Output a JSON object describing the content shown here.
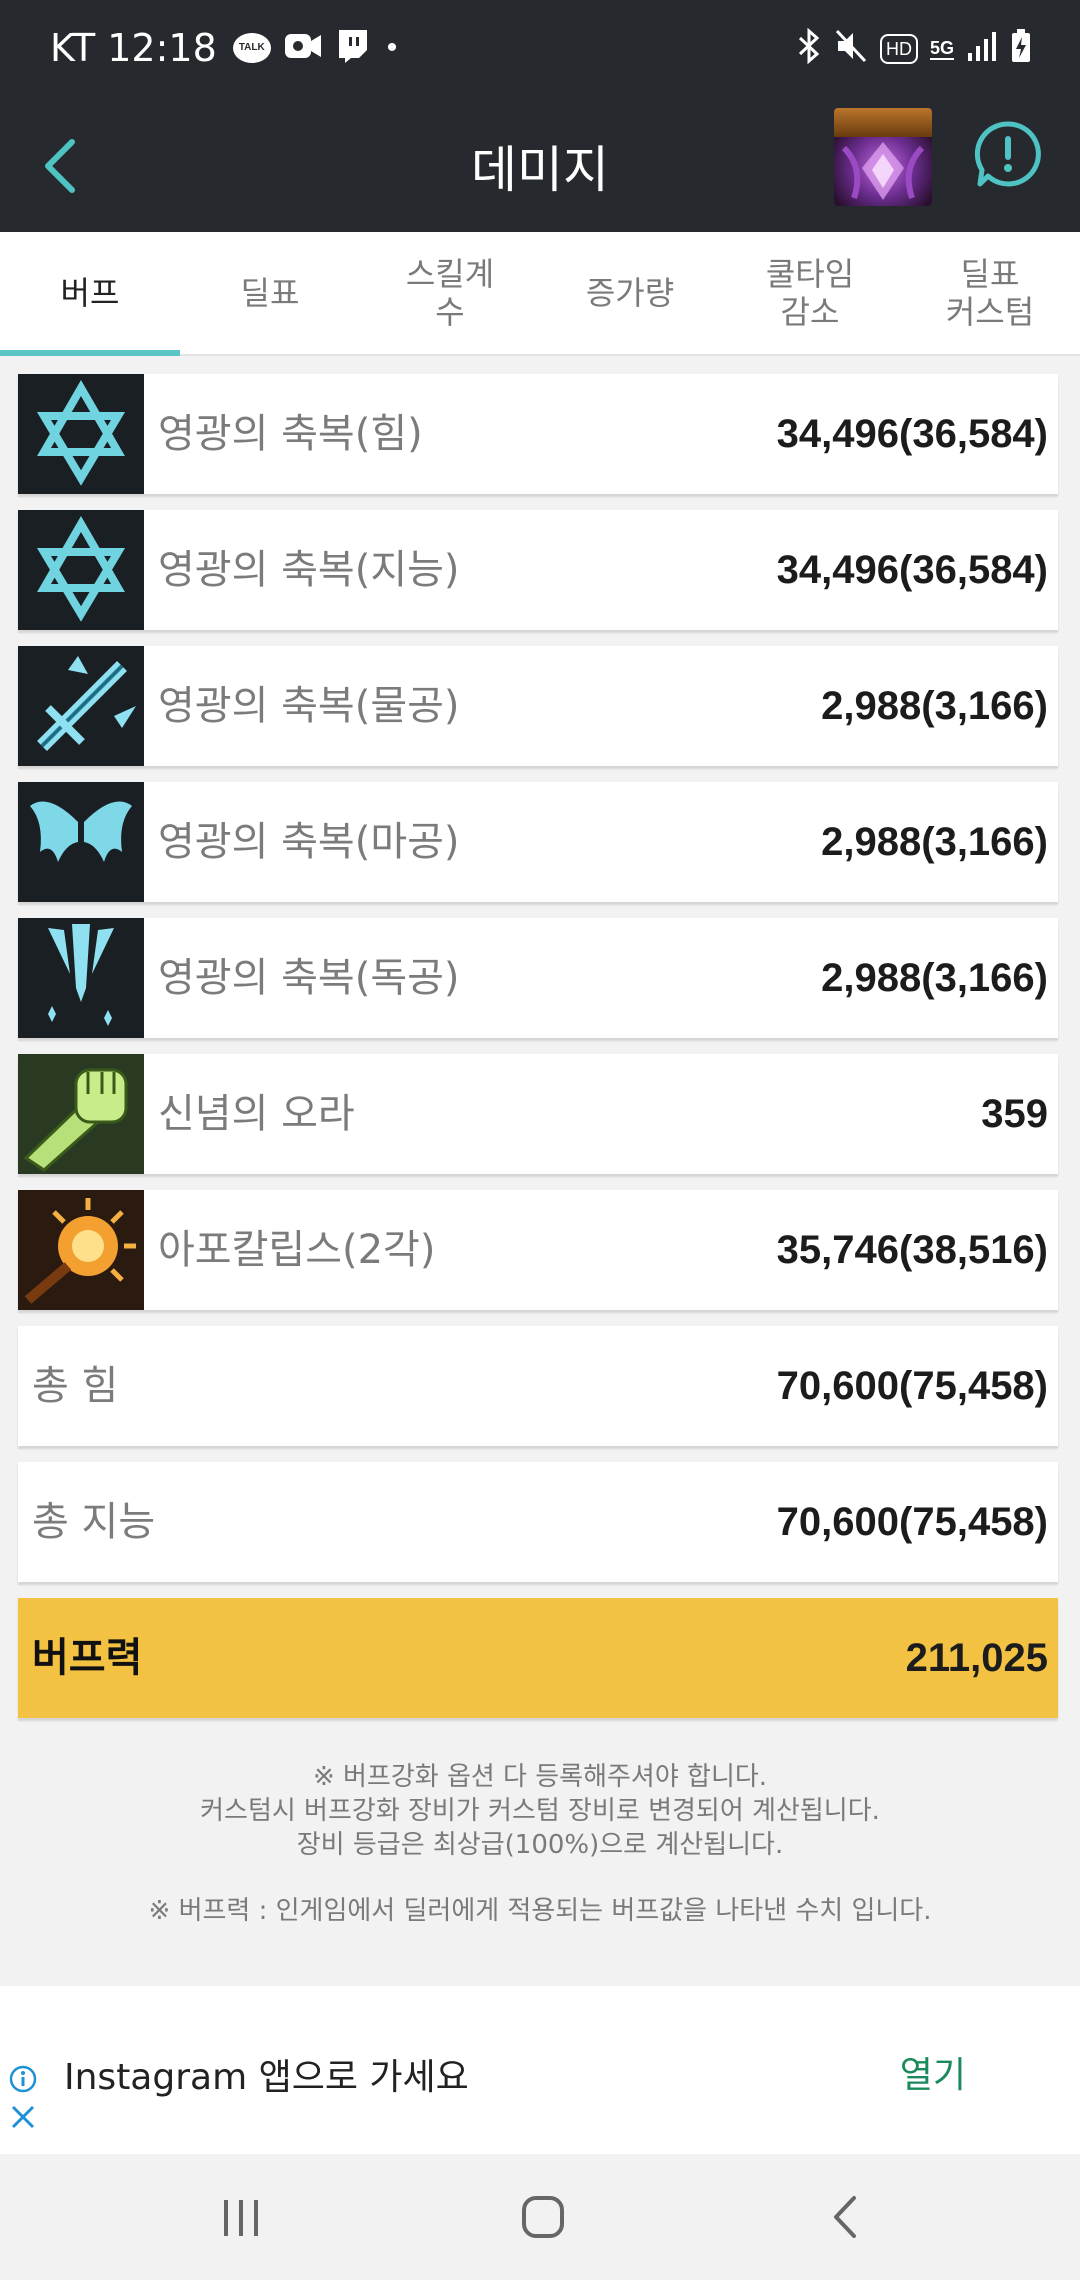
{
  "status_bar": {
    "carrier_time": "KT 12:18",
    "talk_label": "TALK",
    "dot": "•",
    "icons": [
      "talk-icon",
      "video-icon",
      "twitch-icon",
      "bluetooth-icon",
      "mute-icon",
      "hd-icon",
      "5g-icon",
      "signal-icon",
      "battery-icon"
    ],
    "hd_label": "HD",
    "fiveg_label": "5G"
  },
  "header": {
    "title": "데미지",
    "back_icon": "chevron-left-icon",
    "alert_icon": "alert-bubble-icon",
    "accent_color": "#4fc3c3"
  },
  "tabs": [
    {
      "label": "버프",
      "active": true
    },
    {
      "label": "딜표",
      "active": false
    },
    {
      "label": "스킬계\n수",
      "active": false
    },
    {
      "label": "증가량",
      "active": false
    },
    {
      "label": "쿨타임\n감소",
      "active": false
    },
    {
      "label": "딜표\n커스텀",
      "active": false
    }
  ],
  "buffs": [
    {
      "label": "영광의 축복(힘)",
      "value": "34,496(36,584)",
      "icon": "hexagram-icon"
    },
    {
      "label": "영광의 축복(지능)",
      "value": "34,496(36,584)",
      "icon": "hexagram-icon"
    },
    {
      "label": "영광의 축복(물공)",
      "value": "2,988(3,166)",
      "icon": "sword-icon"
    },
    {
      "label": "영광의 축복(마공)",
      "value": "2,988(3,166)",
      "icon": "wings-icon"
    },
    {
      "label": "영광의 축복(독공)",
      "value": "2,988(3,166)",
      "icon": "blade-burst-icon"
    },
    {
      "label": "신념의 오라",
      "value": "359",
      "icon": "fist-icon"
    },
    {
      "label": "아포칼립스(2각)",
      "value": "35,746(38,516)",
      "icon": "apocalypse-icon"
    }
  ],
  "totals": [
    {
      "label": "총 힘",
      "value": "70,600(75,458)"
    },
    {
      "label": "총 지능",
      "value": "70,600(75,458)"
    }
  ],
  "buff_power": {
    "label": "버프력",
    "value": "211,025",
    "color": "#f3c242"
  },
  "notes": [
    "※ 버프강화 옵션 다 등록해주셔야 합니다.",
    "커스텀시 버프강화 장비가 커스텀 장비로 변경되어 계산됩니다.",
    "장비 등급은 최상급(100%)으로 계산됩니다.",
    "※ 버프력 : 인게임에서 딜러에게 적용되는 버프값을 나타낸 수치 입니다."
  ],
  "ad": {
    "text": "Instagram 앱으로 가세요",
    "open_label": "열기"
  },
  "nav": {
    "icons": [
      "recent-apps-icon",
      "home-icon",
      "back-icon"
    ]
  }
}
